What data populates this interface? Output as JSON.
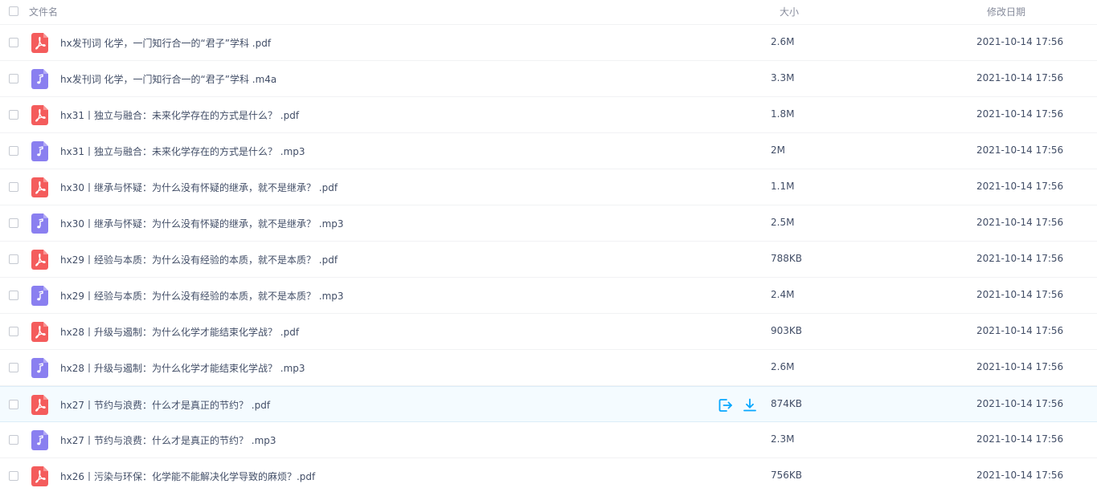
{
  "header": {
    "name_label": "文件名",
    "size_label": "大小",
    "date_label": "修改日期"
  },
  "colors": {
    "pdf_icon": "#f45c5c",
    "audio_icon": "#8a7ff0",
    "action_blue": "#06a7ff",
    "row_hover": "#f4fbff"
  },
  "files": [
    {
      "name": "hx发刊词 化学，一门知行合一的“君子”学科 .pdf",
      "type": "pdf",
      "icon": "pdf-icon",
      "size": "2.6M",
      "date": "2021-10-14 17:56"
    },
    {
      "name": "hx发刊词 化学，一门知行合一的“君子”学科 .m4a",
      "type": "audio",
      "icon": "music-note-icon",
      "size": "3.3M",
      "date": "2021-10-14 17:56"
    },
    {
      "name": "hx31丨独立与融合：未来化学存在的方式是什么？ .pdf",
      "type": "pdf",
      "icon": "pdf-icon",
      "size": "1.8M",
      "date": "2021-10-14 17:56"
    },
    {
      "name": "hx31丨独立与融合：未来化学存在的方式是什么？ .mp3",
      "type": "audio",
      "icon": "music-note-icon",
      "size": "2M",
      "date": "2021-10-14 17:56"
    },
    {
      "name": "hx30丨继承与怀疑：为什么没有怀疑的继承，就不是继承？ .pdf",
      "type": "pdf",
      "icon": "pdf-icon",
      "size": "1.1M",
      "date": "2021-10-14 17:56"
    },
    {
      "name": "hx30丨继承与怀疑：为什么没有怀疑的继承，就不是继承？ .mp3",
      "type": "audio",
      "icon": "music-note-icon",
      "size": "2.5M",
      "date": "2021-10-14 17:56"
    },
    {
      "name": "hx29丨经验与本质：为什么没有经验的本质，就不是本质？ .pdf",
      "type": "pdf",
      "icon": "pdf-icon",
      "size": "788KB",
      "date": "2021-10-14 17:56"
    },
    {
      "name": "hx29丨经验与本质：为什么没有经验的本质，就不是本质？ .mp3",
      "type": "audio",
      "icon": "music-note-icon",
      "size": "2.4M",
      "date": "2021-10-14 17:56"
    },
    {
      "name": "hx28丨升级与遏制：为什么化学才能结束化学战？ .pdf",
      "type": "pdf",
      "icon": "pdf-icon",
      "size": "903KB",
      "date": "2021-10-14 17:56"
    },
    {
      "name": "hx28丨升级与遏制：为什么化学才能结束化学战？ .mp3",
      "type": "audio",
      "icon": "music-note-icon",
      "size": "2.6M",
      "date": "2021-10-14 17:56"
    },
    {
      "name": "hx27丨节约与浪费：什么才是真正的节约？ .pdf",
      "type": "pdf",
      "icon": "pdf-icon",
      "size": "874KB",
      "date": "2021-10-14 17:56",
      "hovered": true
    },
    {
      "name": "hx27丨节约与浪费：什么才是真正的节约？ .mp3",
      "type": "audio",
      "icon": "music-note-icon",
      "size": "2.3M",
      "date": "2021-10-14 17:56"
    },
    {
      "name": "hx26丨污染与环保：化学能不能解决化学导致的麻烦？.pdf",
      "type": "pdf",
      "icon": "pdf-icon",
      "size": "756KB",
      "date": "2021-10-14 17:56"
    }
  ],
  "row_actions": [
    {
      "icon": "share-export-icon"
    },
    {
      "icon": "download-icon"
    }
  ]
}
